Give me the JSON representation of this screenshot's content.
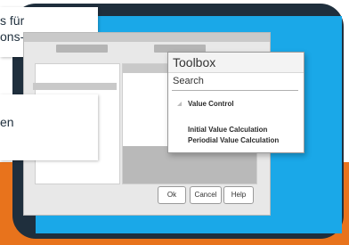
{
  "callouts": {
    "first": {
      "line1": "s für",
      "line2": "ons-"
    },
    "second": {
      "line1": "en"
    }
  },
  "dialog": {
    "buttons": {
      "ok": "Ok",
      "cancel": "Cancel",
      "help": "Help"
    }
  },
  "toolbox": {
    "title": "Toolbox",
    "search_label": "Search",
    "tree": [
      {
        "label": "Value Control"
      },
      {
        "label": "Initial Value Calculation"
      },
      {
        "label": "Periodial Value Calculation"
      }
    ]
  },
  "colors": {
    "screen_blue": "#1aa8e8",
    "tablet_frame": "#1f2f3d",
    "orange_band": "#e8731c"
  }
}
